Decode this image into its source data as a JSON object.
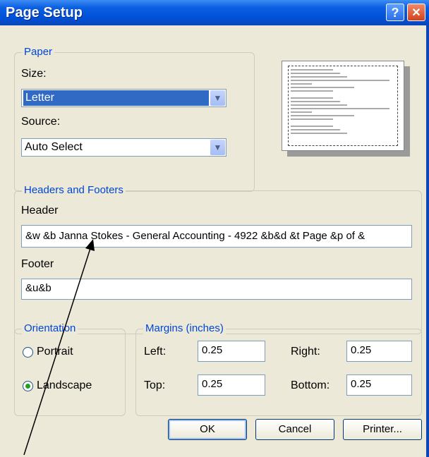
{
  "window": {
    "title": "Page Setup",
    "help_glyph": "?",
    "close_glyph": "✕"
  },
  "paper": {
    "legend": "Paper",
    "size_label": "Size:",
    "size_value": "Letter",
    "source_label": "Source:",
    "source_value": "Auto Select"
  },
  "headers_footers": {
    "legend": "Headers and Footers",
    "header_label": "Header",
    "header_value": "&w &b Janna Stokes - General Accounting - 4922 &b&d &t Page &p of &",
    "footer_label": "Footer",
    "footer_value": "&u&b"
  },
  "orientation": {
    "legend": "Orientation",
    "portrait_label": "Portrait",
    "landscape_label": "Landscape",
    "selected": "Landscape"
  },
  "margins": {
    "legend": "Margins (inches)",
    "left_label": "Left:",
    "left_value": "0.25",
    "right_label": "Right:",
    "right_value": "0.25",
    "top_label": "Top:",
    "top_value": "0.25",
    "bottom_label": "Bottom:",
    "bottom_value": "0.25"
  },
  "buttons": {
    "ok": "OK",
    "cancel": "Cancel",
    "printer": "Printer..."
  },
  "colors": {
    "title_bar": "#0054e3",
    "group_label": "#0046d5",
    "selection": "#316ac5",
    "dialog_bg": "#ece9d8"
  }
}
